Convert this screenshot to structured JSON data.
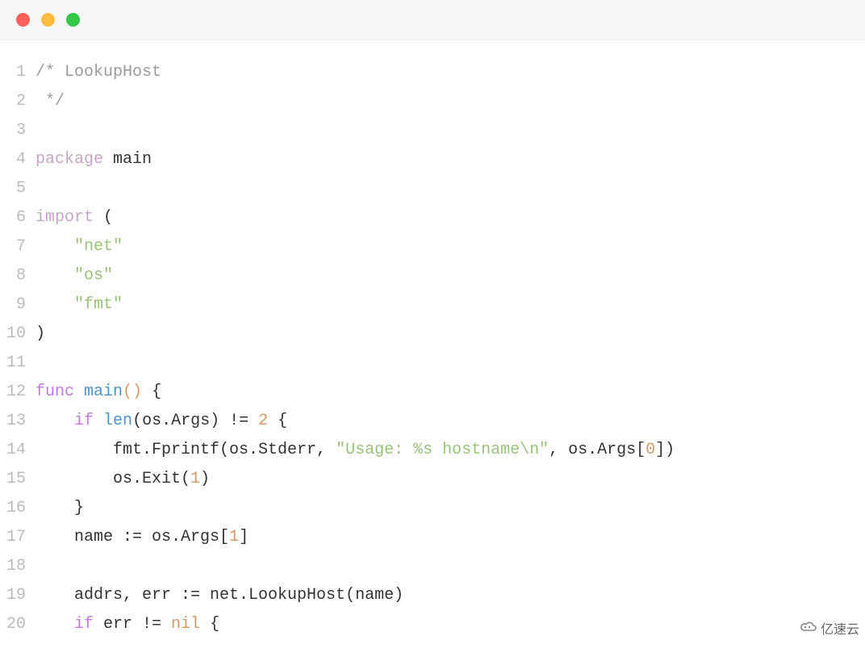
{
  "lines": [
    {
      "n": "1",
      "tokens": [
        {
          "c": "cm",
          "t": "/* LookupHost"
        }
      ]
    },
    {
      "n": "2",
      "tokens": [
        {
          "c": "cm",
          "t": " */"
        }
      ]
    },
    {
      "n": "3",
      "tokens": []
    },
    {
      "n": "4",
      "tokens": [
        {
          "c": "kw2",
          "t": "package"
        },
        {
          "t": " "
        },
        {
          "t": "main"
        }
      ]
    },
    {
      "n": "5",
      "tokens": []
    },
    {
      "n": "6",
      "tokens": [
        {
          "c": "kw2",
          "t": "import"
        },
        {
          "t": " ("
        }
      ]
    },
    {
      "n": "7",
      "tokens": [
        {
          "t": "    "
        },
        {
          "c": "str",
          "t": "\"net\""
        }
      ]
    },
    {
      "n": "8",
      "tokens": [
        {
          "t": "    "
        },
        {
          "c": "str",
          "t": "\"os\""
        }
      ]
    },
    {
      "n": "9",
      "tokens": [
        {
          "t": "    "
        },
        {
          "c": "str",
          "t": "\"fmt\""
        }
      ]
    },
    {
      "n": "10",
      "tokens": [
        {
          "t": ")"
        }
      ]
    },
    {
      "n": "11",
      "tokens": []
    },
    {
      "n": "12",
      "tokens": [
        {
          "c": "kw",
          "t": "func"
        },
        {
          "t": " "
        },
        {
          "c": "fn",
          "t": "main"
        },
        {
          "c": "num",
          "t": "()"
        },
        {
          "t": " {"
        }
      ]
    },
    {
      "n": "13",
      "tokens": [
        {
          "t": "    "
        },
        {
          "c": "kw",
          "t": "if"
        },
        {
          "t": " "
        },
        {
          "c": "fn",
          "t": "len"
        },
        {
          "t": "(os.Args) != "
        },
        {
          "c": "num",
          "t": "2"
        },
        {
          "t": " {"
        }
      ]
    },
    {
      "n": "14",
      "tokens": [
        {
          "t": "        fmt.Fprintf(os.Stderr, "
        },
        {
          "c": "str",
          "t": "\"Usage: %s hostname\\n\""
        },
        {
          "t": ", os.Args["
        },
        {
          "c": "num",
          "t": "0"
        },
        {
          "t": "])"
        }
      ]
    },
    {
      "n": "15",
      "tokens": [
        {
          "t": "        os.Exit("
        },
        {
          "c": "num",
          "t": "1"
        },
        {
          "t": ")"
        }
      ]
    },
    {
      "n": "16",
      "tokens": [
        {
          "t": "    }"
        }
      ]
    },
    {
      "n": "17",
      "tokens": [
        {
          "t": "    name := os.Args["
        },
        {
          "c": "num",
          "t": "1"
        },
        {
          "t": "]"
        }
      ]
    },
    {
      "n": "18",
      "tokens": []
    },
    {
      "n": "19",
      "tokens": [
        {
          "t": "    addrs, err := net.LookupHost(name)"
        }
      ]
    },
    {
      "n": "20",
      "tokens": [
        {
          "t": "    "
        },
        {
          "c": "kw",
          "t": "if"
        },
        {
          "t": " err != "
        },
        {
          "c": "nil",
          "t": "nil"
        },
        {
          "t": " {"
        }
      ]
    }
  ],
  "watermark": {
    "text": "亿速云"
  }
}
